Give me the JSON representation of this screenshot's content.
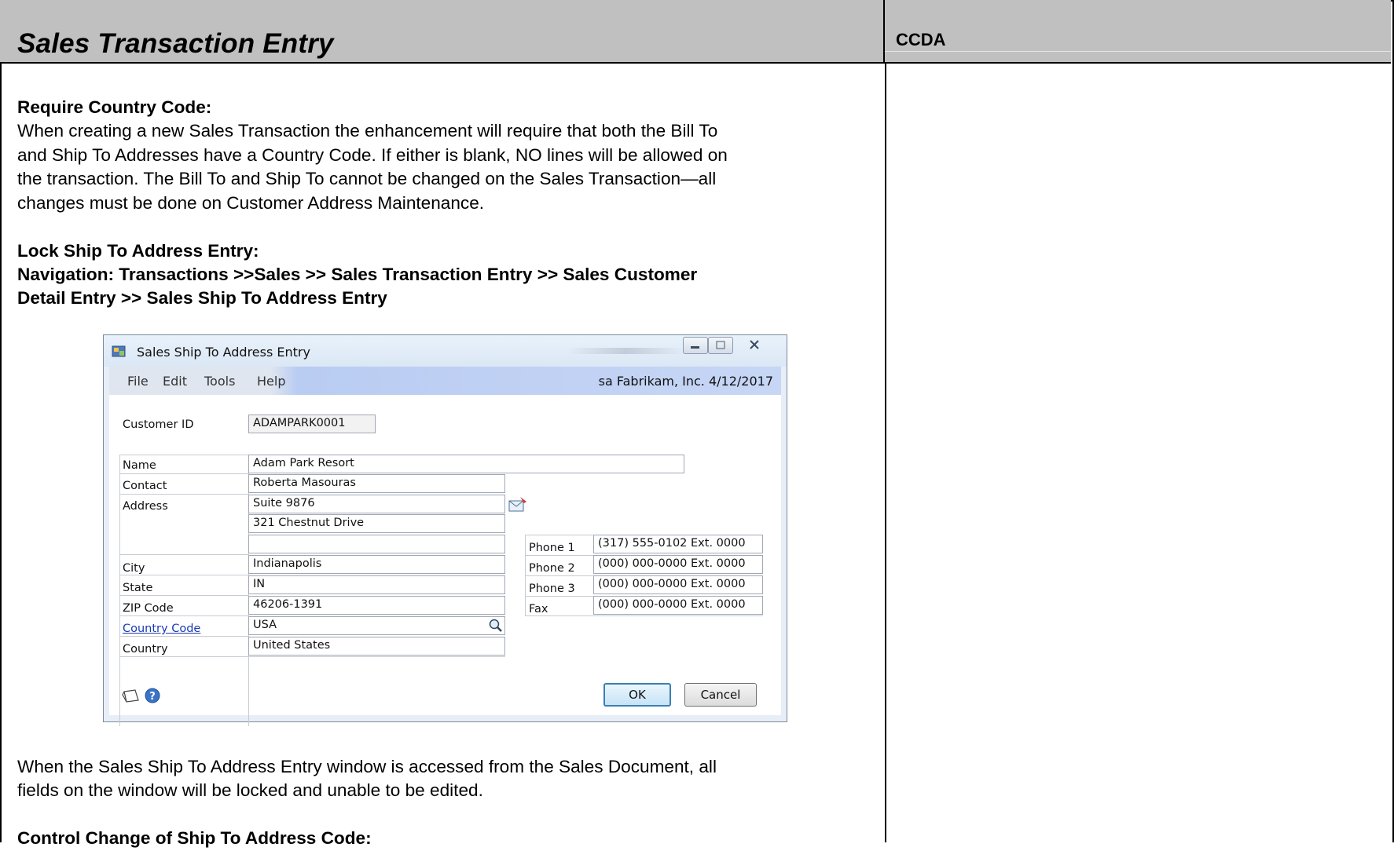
{
  "header": {
    "title": "Sales Transaction Entry",
    "right_label": "CCDA"
  },
  "content": {
    "section1_heading": "Require Country Code:",
    "section1_lines": [
      "When creating a new Sales Transaction the enhancement will require that both the Bill To",
      "and Ship To Addresses have a Country Code.  If either is blank, NO lines will be allowed on",
      "the transaction.  The Bill To and Ship To cannot be changed on the Sales Transaction—all",
      "changes must be done on Customer Address Maintenance."
    ],
    "section2_heading": "Lock Ship To Address Entry:",
    "section2_nav_lines": [
      "Navigation: Transactions >>Sales >> Sales Transaction Entry >> Sales Customer",
      "Detail Entry >> Sales Ship To Address Entry"
    ],
    "after_lines": [
      "When the Sales Ship To Address Entry window is accessed from the Sales Document, all",
      "fields on the window will be locked and unable to be edited."
    ],
    "section3_heading": "Control Change of Ship To Address Code:"
  },
  "dialog": {
    "title": "Sales Ship To Address Entry",
    "menu": [
      "File",
      "Edit",
      "Tools",
      "Help"
    ],
    "user_company_date": "sa  Fabrikam, Inc.  4/12/2017",
    "labels": {
      "customer_id": "Customer ID",
      "name": "Name",
      "contact": "Contact",
      "address": "Address",
      "city": "City",
      "state": "State",
      "zip": "ZIP Code",
      "country_code": "Country Code",
      "country": "Country",
      "phone1": "Phone 1",
      "phone2": "Phone 2",
      "phone3": "Phone 3",
      "fax": "Fax"
    },
    "values": {
      "customer_id": "ADAMPARK0001",
      "name": "Adam Park Resort",
      "contact": "Roberta Masouras",
      "address1": "Suite 9876",
      "address2": "321 Chestnut Drive",
      "address3": "",
      "city": "Indianapolis",
      "state": "IN",
      "zip": "46206-1391",
      "country_code": "USA",
      "country": "United States",
      "phone1": "(317) 555-0102  Ext. 0000",
      "phone2": "(000) 000-0000  Ext. 0000",
      "phone3": "(000) 000-0000  Ext. 0000",
      "fax": "(000) 000-0000  Ext. 0000"
    },
    "buttons": {
      "ok": "OK",
      "cancel": "Cancel"
    }
  }
}
